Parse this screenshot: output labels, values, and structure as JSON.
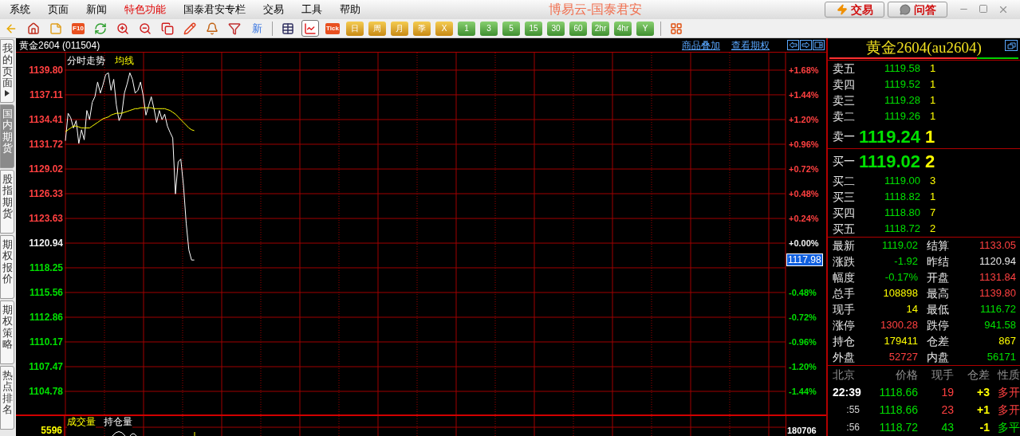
{
  "menu": [
    {
      "label": "系统",
      "highlighted": false
    },
    {
      "label": "页面",
      "highlighted": false
    },
    {
      "label": "新闻",
      "highlighted": false
    },
    {
      "label": "特色功能",
      "highlighted": true
    },
    {
      "label": "国泰君安专栏",
      "highlighted": false
    },
    {
      "label": "交易",
      "highlighted": false
    },
    {
      "label": "工具",
      "highlighted": false
    },
    {
      "label": "帮助",
      "highlighted": false
    }
  ],
  "app_title": "博易云-国泰君安",
  "title_buttons": [
    {
      "kind": "trade",
      "label": "交易"
    },
    {
      "kind": "ask",
      "label": "问答"
    }
  ],
  "toolbar": [
    {
      "kind": "icon",
      "selected": false
    },
    {
      "kind": "icon",
      "selected": false
    },
    {
      "kind": "icon",
      "selected": false
    },
    {
      "kind": "tag",
      "label": "F10",
      "selected": false
    },
    {
      "kind": "icon",
      "selected": false
    },
    {
      "kind": "icon",
      "selected": false
    },
    {
      "kind": "icon",
      "selected": false
    },
    {
      "kind": "icon",
      "selected": false
    },
    {
      "kind": "icon",
      "selected": false
    },
    {
      "kind": "icon",
      "selected": false
    },
    {
      "kind": "icon",
      "selected": false
    },
    {
      "kind": "text",
      "label": "新",
      "selected": false
    },
    {
      "kind": "separator"
    },
    {
      "kind": "icon",
      "selected": false
    },
    {
      "kind": "icon",
      "selected": true
    },
    {
      "kind": "tag",
      "label": "Tick",
      "selected": false
    },
    {
      "kind": "gold",
      "label": "日",
      "selected": false
    },
    {
      "kind": "gold",
      "label": "周",
      "selected": false
    },
    {
      "kind": "gold",
      "label": "月",
      "selected": false
    },
    {
      "kind": "gold",
      "label": "季",
      "selected": false
    },
    {
      "kind": "gold",
      "label": "X",
      "selected": false
    },
    {
      "kind": "green",
      "label": "1",
      "selected": false
    },
    {
      "kind": "green",
      "label": "3",
      "selected": false
    },
    {
      "kind": "green",
      "label": "5",
      "selected": false
    },
    {
      "kind": "green",
      "label": "15",
      "selected": false
    },
    {
      "kind": "green",
      "label": "30",
      "selected": false
    },
    {
      "kind": "green",
      "label": "60",
      "selected": false
    },
    {
      "kind": "green",
      "label": "2hr",
      "selected": false
    },
    {
      "kind": "green",
      "label": "4hr",
      "selected": false
    },
    {
      "kind": "green",
      "label": "Y",
      "selected": false
    },
    {
      "kind": "separator"
    },
    {
      "kind": "icon",
      "selected": false
    }
  ],
  "side_tabs": [
    {
      "label": "我的页面",
      "selected": false,
      "arrow": true
    },
    {
      "label": "国内期货",
      "selected": true,
      "arrow": false
    },
    {
      "label": "股指期货",
      "selected": false,
      "arrow": false
    },
    {
      "label": "期权报价",
      "selected": false,
      "arrow": false
    },
    {
      "label": "期权策略",
      "selected": false,
      "arrow": false
    },
    {
      "label": "热点排名",
      "selected": false,
      "arrow": false
    }
  ],
  "chart": {
    "title": "黄金2604 (011504)",
    "links": [
      "商品叠加",
      "查看期权"
    ],
    "last_price": "1117.98",
    "chart_data": {
      "type": "line",
      "ylim": [
        1102.26,
        1141.71
      ],
      "y2lim": [
        -1.666,
        1.853
      ],
      "grid": true,
      "categories": [
        null,
        null,
        null,
        null,
        null,
        null,
        null,
        null,
        null,
        null,
        null,
        null,
        null,
        null,
        null,
        null,
        null,
        null,
        null,
        null,
        null,
        null,
        null,
        null,
        null,
        null,
        null,
        null,
        null,
        null,
        null,
        null,
        null,
        null,
        null,
        null,
        null,
        null,
        null,
        null,
        null,
        null,
        null,
        null,
        null,
        null,
        null,
        null,
        null,
        null,
        null,
        null,
        null,
        null,
        null,
        null,
        null,
        null,
        null,
        null,
        null,
        null,
        null,
        null,
        null,
        null,
        null,
        null,
        null,
        null,
        null,
        null,
        null,
        null,
        null,
        null,
        null,
        null,
        null,
        null,
        null,
        null,
        null,
        null,
        null,
        null,
        null,
        null,
        null,
        null,
        null,
        null,
        null,
        null,
        null,
        null,
        null,
        null,
        null,
        null,
        null,
        null,
        null,
        null,
        null,
        null,
        null,
        null,
        null,
        null,
        null,
        null,
        null,
        null,
        null,
        null,
        null,
        null,
        null,
        null,
        null,
        null,
        null,
        null,
        null,
        null,
        null,
        null,
        null,
        null,
        null,
        null,
        null,
        null,
        null,
        null,
        null,
        null,
        null,
        null,
        null,
        null,
        null,
        null,
        null,
        null,
        null,
        null,
        null,
        null,
        null,
        null,
        null,
        null,
        null,
        null,
        null,
        null,
        null,
        null,
        null,
        null,
        null,
        null,
        null,
        null,
        null,
        null,
        null,
        null,
        null,
        null,
        null,
        null,
        null,
        null,
        null,
        null,
        null,
        null,
        null,
        null,
        null,
        null,
        null,
        null,
        null,
        null,
        null,
        null,
        null,
        null,
        null,
        null,
        null,
        null,
        null,
        null,
        null,
        null,
        null,
        null,
        null,
        null,
        null,
        null,
        null,
        null,
        null,
        null,
        null,
        null,
        null,
        null,
        null,
        null,
        null,
        null,
        null,
        null,
        null,
        null,
        null,
        null,
        null,
        null,
        null,
        null,
        null,
        null,
        null,
        null,
        null,
        null,
        null,
        null,
        null,
        null,
        null,
        null,
        null,
        null,
        null,
        null,
        null,
        null,
        null,
        null,
        null,
        null,
        null,
        null,
        null,
        null,
        null,
        null,
        null,
        null,
        null,
        null,
        null,
        null,
        null,
        null,
        null,
        null,
        null,
        null,
        null
      ],
      "yticks": [
        {
          "value": 1139.8,
          "label": "1139.80"
        },
        {
          "value": 1137.11,
          "label": "1137.11"
        },
        {
          "value": 1134.41,
          "label": "1134.41"
        },
        {
          "value": 1131.72,
          "label": "1131.72"
        },
        {
          "value": 1129.02,
          "label": "1129.02"
        },
        {
          "value": 1126.33,
          "label": "1126.33"
        },
        {
          "value": 1123.63,
          "label": "1123.63"
        },
        {
          "value": 1120.94,
          "label": "1120.94"
        },
        {
          "value": 1118.25,
          "label": "1118.25"
        },
        {
          "value": 1115.56,
          "label": "1115.56"
        },
        {
          "value": 1112.86,
          "label": "1112.86"
        },
        {
          "value": 1110.17,
          "label": "1110.17"
        },
        {
          "value": 1107.47,
          "label": "1107.47"
        },
        {
          "value": 1104.78,
          "label": "1104.78"
        }
      ],
      "y2ticks": [
        {
          "value": 1.68,
          "label": "+1.68%"
        },
        {
          "value": 1.44,
          "label": "+1.44%"
        },
        {
          "value": 1.2,
          "label": "+1.20%"
        },
        {
          "value": 0.96,
          "label": "+0.96%"
        },
        {
          "value": 0.72,
          "label": "+0.72%"
        },
        {
          "value": 0.48,
          "label": "+0.48%"
        },
        {
          "value": 0.24,
          "label": "+0.24%"
        },
        {
          "value": 0,
          "label": "+0.00%"
        },
        {
          "value": -0.48,
          "label": "-0.48%"
        },
        {
          "value": -0.72,
          "label": "-0.72%"
        },
        {
          "value": -0.96,
          "label": "-0.96%"
        },
        {
          "value": -1.2,
          "label": "-1.20%"
        },
        {
          "value": -1.44,
          "label": "-1.44%"
        }
      ],
      "series": [
        {
          "name": "分时走势",
          "color": "#ffffff",
          "values": [
            1132.1,
            1135.1,
            1134.6,
            1133.5,
            1134.3,
            1131.8,
            1133.3,
            1132.2,
            1135.4,
            1134.4,
            1136.3,
            1136.9,
            1138.5,
            1137.3,
            1138.2,
            1139.3,
            1139.5,
            1137.6,
            1138.8,
            1136.0,
            1134.3,
            1135.0,
            1137.3,
            1138.3,
            1139.5,
            1138.8,
            1137.3,
            1137.6,
            1138.5,
            1137.0,
            1134.9,
            1135.9,
            1136.9,
            1135.6,
            1134.1,
            1135.4,
            1134.4,
            1135.0,
            1133.7,
            1133.0,
            1132.4,
            1126.3,
            1129.8,
            1130.1,
            1127.2,
            1123.1,
            1120.2,
            1119.1,
            1119.1,
            null,
            null,
            null,
            null,
            null,
            null,
            null,
            null,
            null,
            null,
            null,
            null,
            null,
            null,
            null,
            null,
            null,
            null,
            null,
            null,
            null,
            null,
            null,
            null,
            null,
            null,
            null,
            null,
            null,
            null,
            null,
            null,
            null,
            null,
            null,
            null,
            null,
            null,
            null,
            null,
            null,
            null,
            null,
            null,
            null,
            null,
            null,
            null,
            null,
            null,
            null,
            null,
            null,
            null,
            null,
            null,
            null,
            null,
            null,
            null,
            null,
            null,
            null,
            null,
            null,
            null,
            null,
            null,
            null,
            null,
            null,
            null,
            null,
            null,
            null,
            null,
            null,
            null,
            null,
            null,
            null,
            null,
            null,
            null,
            null,
            null,
            null,
            null,
            null,
            null,
            null,
            null,
            null,
            null,
            null,
            null,
            null,
            null,
            null,
            null,
            null,
            null,
            null,
            null,
            null,
            null,
            null,
            null,
            null,
            null,
            null,
            null,
            null,
            null,
            null,
            null,
            null,
            null,
            null,
            null,
            null,
            null,
            null,
            null,
            null,
            null,
            null,
            null,
            null,
            null,
            null,
            null,
            null,
            null,
            null,
            null,
            null,
            null,
            null,
            null,
            null,
            null,
            null,
            null,
            null,
            null,
            null,
            null,
            null,
            null,
            null,
            null,
            null,
            null,
            null,
            null,
            null,
            null,
            null,
            null,
            null,
            null,
            null,
            null,
            null,
            null,
            null,
            null,
            null,
            null,
            null,
            null,
            null,
            null,
            null,
            null,
            null,
            null,
            null,
            null,
            null,
            null,
            null,
            null,
            null,
            null,
            null,
            null,
            null,
            null,
            null,
            null,
            null,
            null,
            null,
            null,
            null,
            null,
            null,
            null,
            null,
            null,
            null,
            null,
            null,
            null,
            null,
            null,
            null,
            null,
            null,
            null,
            null,
            null,
            null,
            null,
            null,
            null,
            null,
            null
          ]
        },
        {
          "name": "均线",
          "color": "#ffff00",
          "values": [
            1133.1,
            1133.3,
            1133.5,
            1133.7,
            1133.7,
            1133.6,
            1133.5,
            1133.5,
            1133.5,
            1133.5,
            1133.7,
            1133.9,
            1134.1,
            1134.3,
            1134.5,
            1134.6,
            1134.7,
            1134.9,
            1135.0,
            1135.1,
            1135.1,
            1135.1,
            1135.2,
            1135.3,
            1135.4,
            1135.5,
            1135.6,
            1135.6,
            1135.7,
            1135.7,
            1135.7,
            1135.7,
            1135.7,
            1135.6,
            1135.6,
            1135.6,
            1135.6,
            1135.6,
            1135.5,
            1135.4,
            1135.2,
            1135.0,
            1134.7,
            1134.4,
            1134.1,
            1133.8,
            1133.5,
            1133.3,
            1133.2,
            null,
            null,
            null,
            null,
            null,
            null,
            null,
            null,
            null,
            null,
            null,
            null,
            null,
            null,
            null,
            null,
            null,
            null,
            null,
            null,
            null,
            null,
            null,
            null,
            null,
            null,
            null,
            null,
            null,
            null,
            null,
            null,
            null,
            null,
            null,
            null,
            null,
            null,
            null,
            null,
            null,
            null,
            null,
            null,
            null,
            null,
            null,
            null,
            null,
            null,
            null,
            null,
            null,
            null,
            null,
            null,
            null,
            null,
            null,
            null,
            null,
            null,
            null,
            null,
            null,
            null,
            null,
            null,
            null,
            null,
            null,
            null,
            null,
            null,
            null,
            null,
            null,
            null,
            null,
            null,
            null,
            null,
            null,
            null,
            null,
            null,
            null,
            null,
            null,
            null,
            null,
            null,
            null,
            null,
            null,
            null,
            null,
            null,
            null,
            null,
            null,
            null,
            null,
            null,
            null,
            null,
            null,
            null,
            null,
            null,
            null,
            null,
            null,
            null,
            null,
            null,
            null,
            null,
            null,
            null,
            null,
            null,
            null,
            null,
            null,
            null,
            null,
            null,
            null,
            null,
            null,
            null,
            null,
            null,
            null,
            null,
            null,
            null,
            null,
            null,
            null,
            null,
            null,
            null,
            null,
            null,
            null,
            null,
            null,
            null,
            null,
            null,
            null,
            null,
            null,
            null,
            null,
            null,
            null,
            null,
            null,
            null,
            null,
            null,
            null,
            null,
            null,
            null,
            null,
            null,
            null,
            null,
            null,
            null,
            null,
            null,
            null,
            null,
            null,
            null,
            null,
            null,
            null,
            null,
            null,
            null,
            null,
            null,
            null,
            null,
            null,
            null,
            null,
            null,
            null,
            null,
            null,
            null,
            null,
            null,
            null,
            null,
            null,
            null,
            null,
            null,
            null,
            null,
            null,
            null,
            null,
            null,
            null,
            null,
            null,
            null,
            null,
            null,
            null,
            null
          ]
        }
      ]
    },
    "volume_pane": {
      "tabs": [
        {
          "label": "成交量",
          "selected": true
        },
        {
          "label": "持仓量",
          "selected": false
        }
      ],
      "left_value": "5596",
      "right_value": "180706"
    }
  },
  "quote": {
    "title": "黄金2604(au2604)",
    "ratio": {
      "level": 0.78
    },
    "asks": [
      {
        "kind": "level",
        "label": "卖五",
        "price": "1119.58",
        "volume": "1"
      },
      {
        "kind": "level",
        "label": "卖四",
        "price": "1119.52",
        "volume": "1"
      },
      {
        "kind": "level",
        "label": "卖三",
        "price": "1119.28",
        "volume": "1"
      },
      {
        "kind": "level",
        "label": "卖二",
        "price": "1119.26",
        "volume": "1"
      },
      {
        "kind": "best",
        "label": "卖一",
        "price": "1119.24",
        "volume": "1"
      }
    ],
    "bids": [
      {
        "kind": "best",
        "label": "买一",
        "price": "1119.02",
        "volume": "2"
      },
      {
        "kind": "level",
        "label": "买二",
        "price": "1119.00",
        "volume": "3"
      },
      {
        "kind": "level",
        "label": "买三",
        "price": "1118.82",
        "volume": "1"
      },
      {
        "kind": "level",
        "label": "买四",
        "price": "1118.80",
        "volume": "7"
      },
      {
        "kind": "level",
        "label": "买五",
        "price": "1118.72",
        "volume": "2"
      }
    ],
    "stats": [
      {
        "label": "最新",
        "value": "1119.02",
        "color": "#00e000"
      },
      {
        "label": "结算",
        "value": "1133.05",
        "color": "#ff4040"
      },
      {
        "label": "涨跌",
        "value": "-1.92",
        "color": "#00e000"
      },
      {
        "label": "昨结",
        "value": "1120.94",
        "color": "#e8e8e8"
      },
      {
        "label": "幅度",
        "value": "-0.17%",
        "color": "#00e000"
      },
      {
        "label": "开盘",
        "value": "1131.84",
        "color": "#ff4040"
      },
      {
        "label": "总手",
        "value": "108898",
        "color": "#ffff00"
      },
      {
        "label": "最高",
        "value": "1139.80",
        "color": "#ff4040"
      },
      {
        "label": "现手",
        "value": "14",
        "color": "#ffff00"
      },
      {
        "label": "最低",
        "value": "1116.72",
        "color": "#00e000"
      },
      {
        "label": "涨停",
        "value": "1300.28",
        "color": "#ff4040"
      },
      {
        "label": "跌停",
        "value": "941.58",
        "color": "#00e000"
      },
      {
        "label": "持仓",
        "value": "179411",
        "color": "#ffff00"
      },
      {
        "label": "仓差",
        "value": "867",
        "color": "#ffff00"
      },
      {
        "label": "外盘",
        "value": "52727",
        "color": "#ff4040"
      },
      {
        "label": "内盘",
        "value": "56171",
        "color": "#00e000"
      }
    ],
    "trades": {
      "columns": [
        "北京",
        "价格",
        "现手",
        "仓差",
        "性质"
      ],
      "rows": [
        {
          "kind": "full",
          "time": "22:39",
          "price": "1118.66",
          "volume": "19",
          "change": "+3",
          "type": "多开",
          "color": "#ff4040"
        },
        {
          "kind": "short",
          "time": ":55",
          "price": "1118.66",
          "volume": "23",
          "change": "+1",
          "type": "多开",
          "color": "#ff4040"
        },
        {
          "kind": "short",
          "time": ":56",
          "price": "1118.72",
          "volume": "43",
          "change": "-1",
          "type": "多平",
          "color": "#00e000"
        }
      ]
    }
  }
}
